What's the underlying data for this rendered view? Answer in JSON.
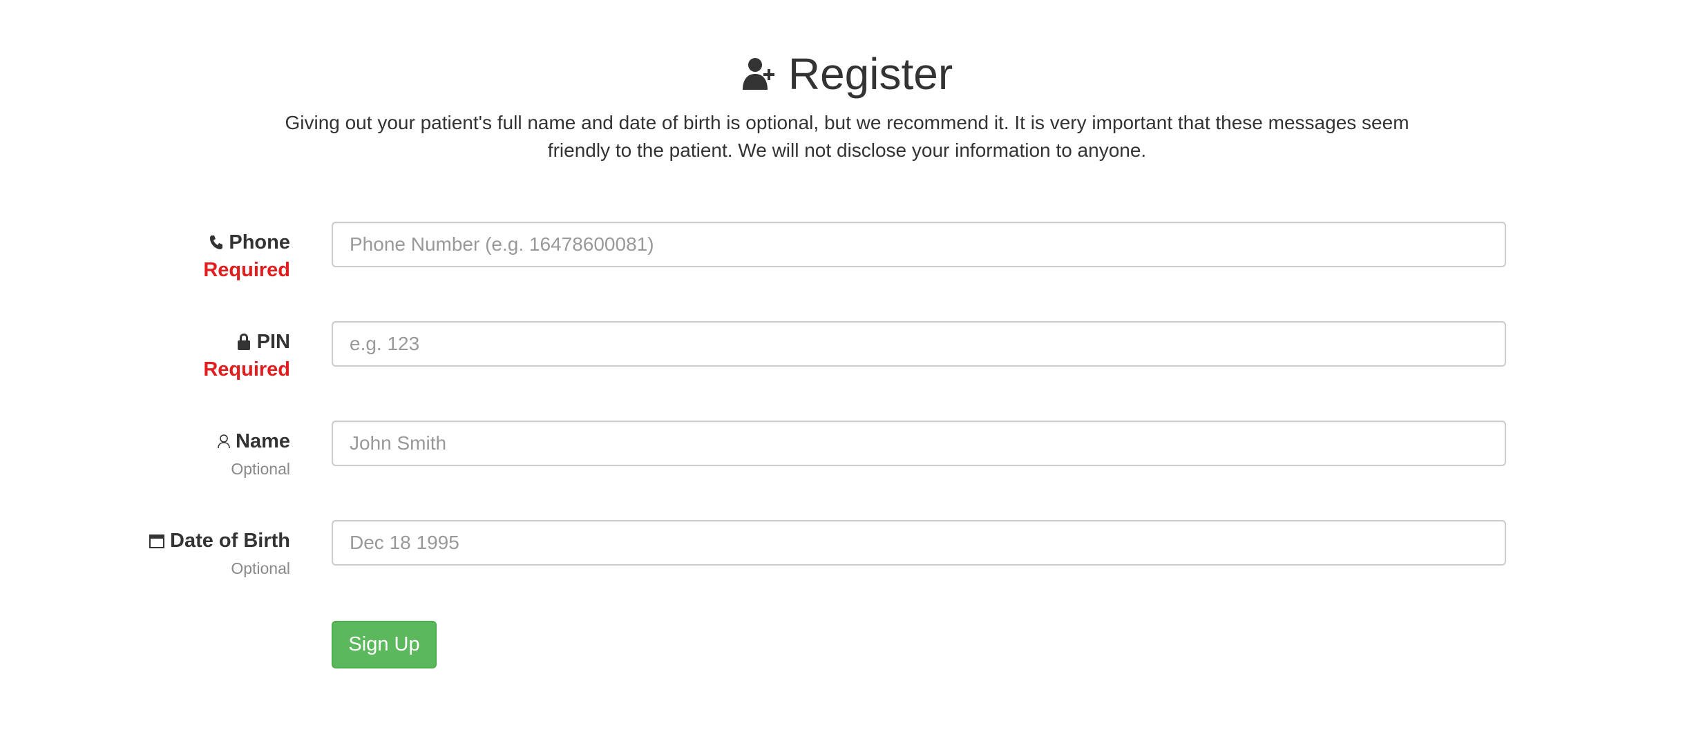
{
  "header": {
    "title": "Register",
    "title_icon": "add-user-icon",
    "subtitle": "Giving out your patient's full name and date of birth is optional, but we recommend it. It is very important that these messages seem friendly to the patient. We will not disclose your information to anyone."
  },
  "form": {
    "fields": [
      {
        "label": "Phone",
        "icon": "phone-icon",
        "status": "Required",
        "placeholder": "Phone Number (e.g. 16478600081)",
        "value": ""
      },
      {
        "label": "PIN",
        "icon": "lock-icon",
        "status": "Required",
        "placeholder": "e.g. 123",
        "value": ""
      },
      {
        "label": "Name",
        "icon": "user-icon",
        "status": "Optional",
        "placeholder": "John Smith",
        "value": ""
      },
      {
        "label": "Date of Birth",
        "icon": "calendar-icon",
        "status": "Optional",
        "placeholder": "Dec 18 1995",
        "value": ""
      }
    ],
    "submit_label": "Sign Up"
  },
  "colors": {
    "required": "#e31d1d",
    "optional": "#888888",
    "submit_bg": "#5cb85c",
    "input_border": "#cccccc",
    "text": "#333333"
  }
}
